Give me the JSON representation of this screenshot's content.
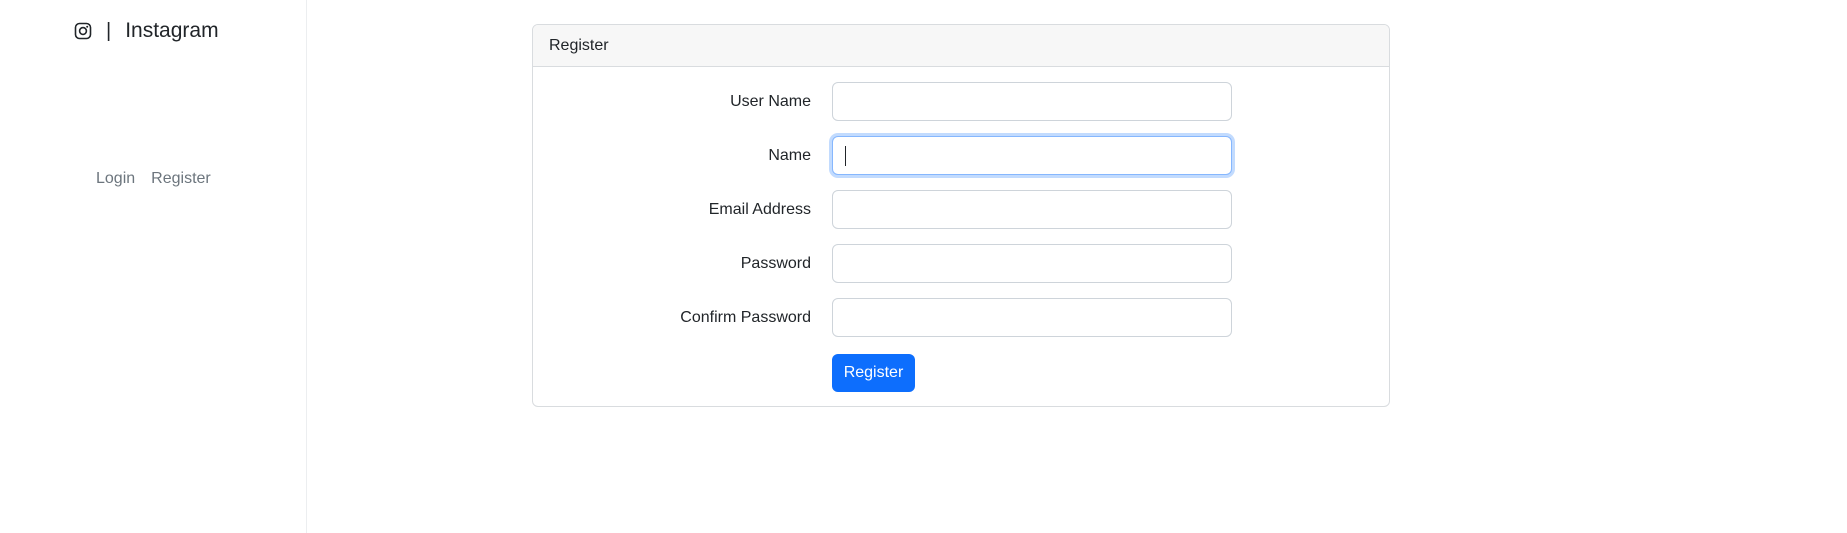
{
  "brand": {
    "icon": "instagram-icon",
    "separator": "|",
    "title": "Instagram"
  },
  "sidebar": {
    "links": [
      {
        "label": "Login"
      },
      {
        "label": "Register"
      }
    ]
  },
  "card": {
    "header": "Register",
    "fields": [
      {
        "label": "User Name",
        "value": ""
      },
      {
        "label": "Name",
        "value": "",
        "focused": true
      },
      {
        "label": "Email Address",
        "value": ""
      },
      {
        "label": "Password",
        "value": ""
      },
      {
        "label": "Confirm Password",
        "value": ""
      }
    ],
    "submit_label": "Register"
  },
  "colors": {
    "primary": "#0d6efd",
    "focus_border": "#86b7fe",
    "muted_text": "#6c757d"
  }
}
